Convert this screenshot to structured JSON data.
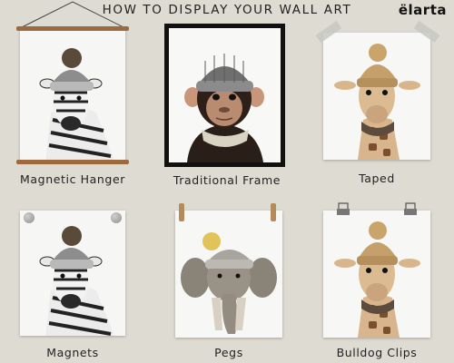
{
  "header": {
    "title": "HOW TO DISPLAY YOUR WALL ART",
    "brand": "ëlarta"
  },
  "captions": {
    "magnetic_hanger": "Magnetic Hanger",
    "traditional_frame": "Traditional Frame",
    "taped": "Taped",
    "magnets": "Magnets",
    "pegs": "Pegs",
    "bulldog_clips": "Bulldog Clips"
  },
  "colors": {
    "background": "#dedbd2",
    "hanger_wood": "#9c6a3c",
    "frame": "#111111"
  },
  "artworks": [
    "zebra",
    "chimpanzee",
    "giraffe",
    "zebra",
    "elephant",
    "giraffe"
  ]
}
